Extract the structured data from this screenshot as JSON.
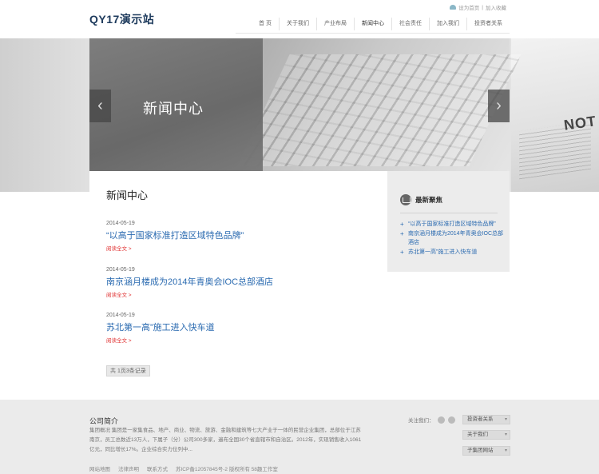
{
  "header": {
    "logo": "QY17演示站",
    "top_links": {
      "home": "设为首页",
      "separator": "|",
      "favorite": "加入收藏"
    },
    "nav": [
      "首 页",
      "关于我们",
      "产业布局",
      "新闻中心",
      "社会责任",
      "加入我们",
      "投资者关系"
    ]
  },
  "banner": {
    "title": "新闻中心",
    "prev_arrow": "‹",
    "next_arrow": "›",
    "paper_text": "NOT"
  },
  "main": {
    "section_title": "新闻中心",
    "news": [
      {
        "date": "2014-05-19",
        "title": "“以高于国家标准打造区域特色品牌”",
        "more": "阅读全文 >"
      },
      {
        "date": "2014-05-19",
        "title": "南京涵月楼成为2014年青奥会IOC总部酒店",
        "more": "阅读全文 >"
      },
      {
        "date": "2014-05-19",
        "title": "苏北第一高”施工进入快车道",
        "more": "阅读全文 >"
      }
    ],
    "pager": "共 1页3条记录"
  },
  "sidebar": {
    "title": "最新聚焦",
    "items": [
      "“以高于国家标准打造区域特色品牌”",
      "南京涵月楼成为2014年青奥会IOC总部酒店",
      "苏北第一高”施工进入快车道"
    ]
  },
  "footer": {
    "title": "公司简介",
    "text": "集团概况 集团是一家集食品、地产、商业、物流、旅游、金融和建筑等七大产业于一体的民营企业集团，总部位于江苏南京，员工总数近13万人，下属子（分）公司300多家，遍布全国30个省直辖市和自治区。2012年，实现销售收入1061亿元，同比增长17%。企业综合实力位列中...",
    "links": [
      "网站地图",
      "法律声明",
      "联系方式",
      "苏ICP备12057845号-2 版权所有 58趣工作室"
    ],
    "follow_label": "关注我们：",
    "dropdowns": [
      "投资者关系",
      "关于我们",
      "子集团网站"
    ]
  }
}
